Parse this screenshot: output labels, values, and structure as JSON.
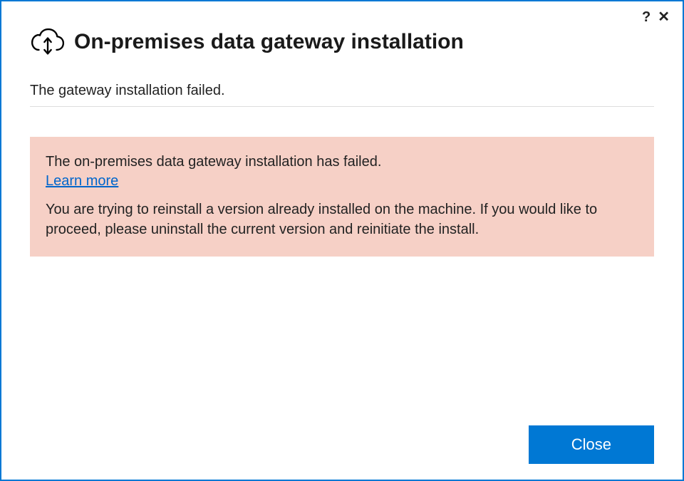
{
  "header": {
    "title": "On-premises data gateway installation"
  },
  "status": {
    "message": "The gateway installation failed."
  },
  "error": {
    "heading": "The on-premises data gateway installation has failed.",
    "link_label": "Learn more",
    "detail": "You are trying to reinstall a version already installed on the machine. If you would like to proceed, please uninstall the current version and reinitiate the install."
  },
  "footer": {
    "close_label": "Close"
  },
  "titlebar": {
    "help": "?",
    "close": "✕"
  }
}
